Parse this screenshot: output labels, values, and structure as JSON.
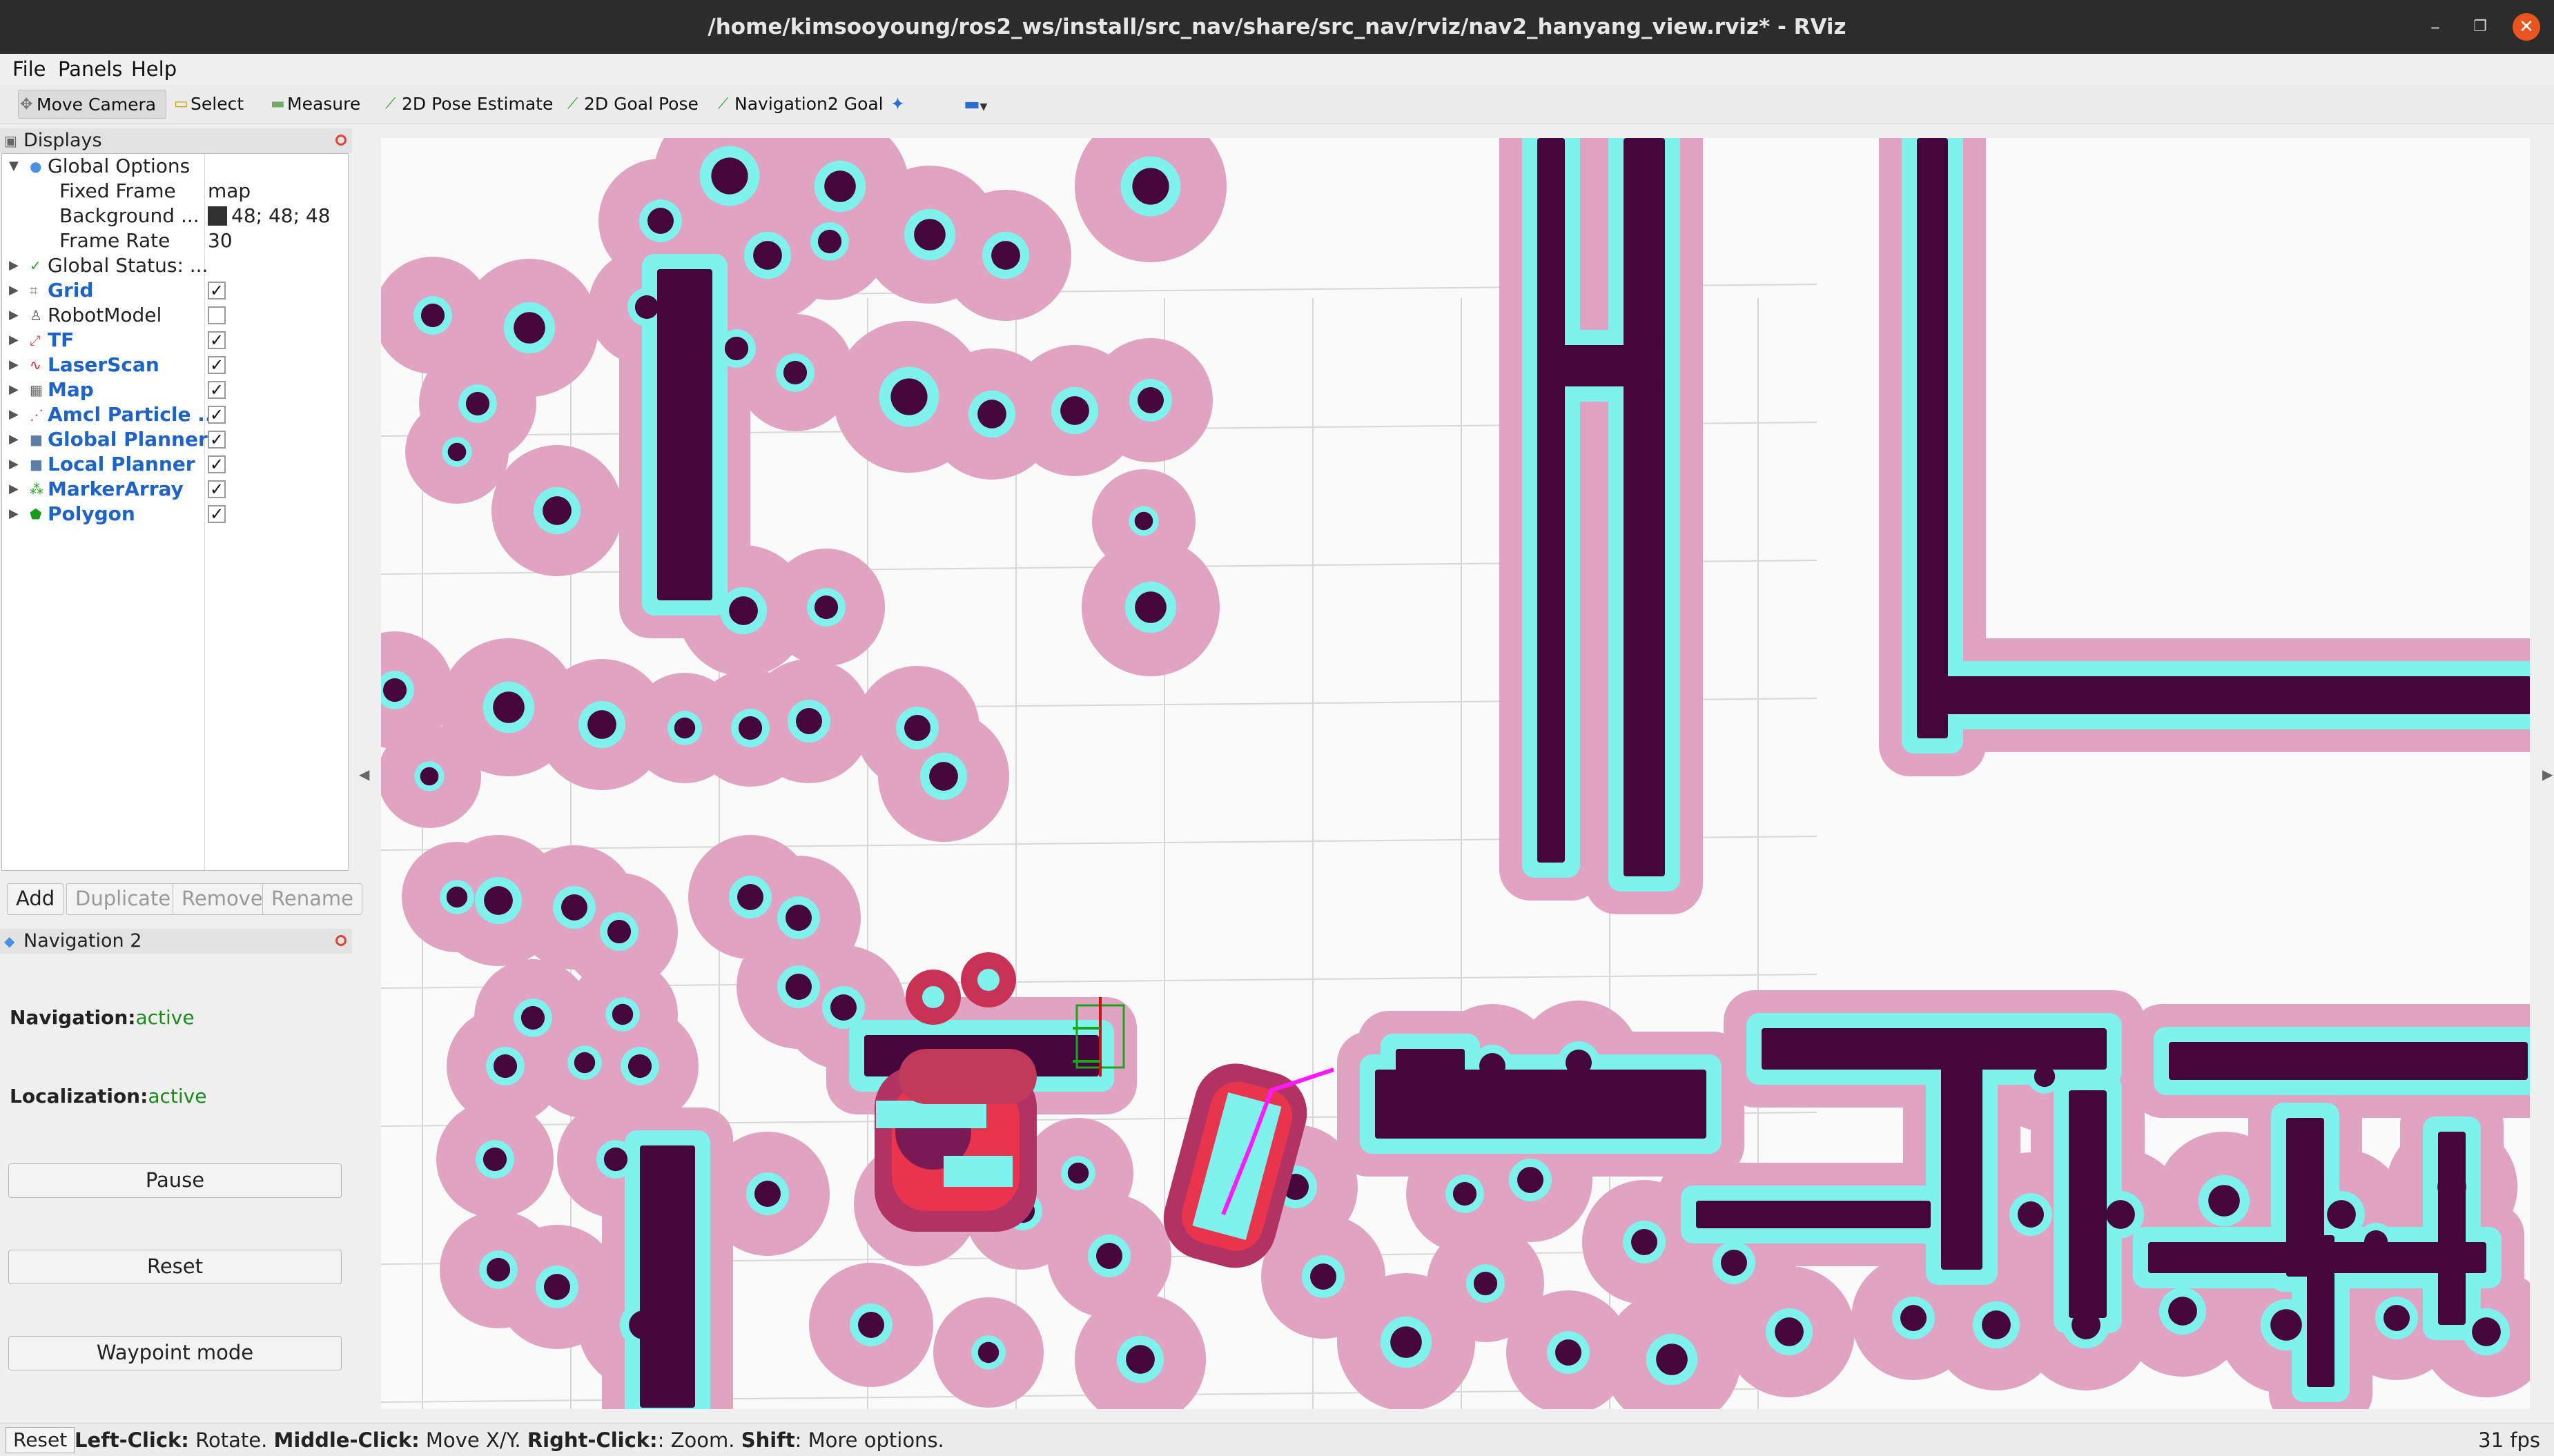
{
  "window": {
    "title": "/home/kimsooyoung/ros2_ws/install/src_nav/share/src_nav/rviz/nav2_hanyang_view.rviz* - RViz"
  },
  "menu": [
    "File",
    "Panels",
    "Help"
  ],
  "toolbar": {
    "move_camera": "Move Camera",
    "select": "Select",
    "measure": "Measure",
    "pose_estimate": "2D Pose Estimate",
    "goal_pose": "2D Goal Pose",
    "nav2_goal": "Navigation2 Goal"
  },
  "displays": {
    "title": "Displays",
    "global_options": "Global Options",
    "fixed_frame": {
      "label": "Fixed Frame",
      "value": "map"
    },
    "background": {
      "label": "Background ...",
      "value": "48; 48; 48",
      "color": "#303030"
    },
    "frame_rate": {
      "label": "Frame Rate",
      "value": "30"
    },
    "global_status": "Global Status: ...",
    "items": [
      {
        "label": "Grid",
        "checked": true
      },
      {
        "label": "RobotModel",
        "checked": false
      },
      {
        "label": "TF",
        "checked": true
      },
      {
        "label": "LaserScan",
        "checked": true
      },
      {
        "label": "Map",
        "checked": true
      },
      {
        "label": "Amcl Particle ...",
        "checked": true
      },
      {
        "label": "Global Planner",
        "checked": true
      },
      {
        "label": "Local Planner",
        "checked": true
      },
      {
        "label": "MarkerArray",
        "checked": true
      },
      {
        "label": "Polygon",
        "checked": true
      }
    ],
    "check_mark": "✓",
    "buttons": {
      "add": "Add",
      "duplicate": "Duplicate",
      "remove": "Remove",
      "rename": "Rename"
    }
  },
  "navigation": {
    "title": "Navigation 2",
    "nav_label": "Navigation:",
    "nav_state": "active",
    "loc_label": "Localization:",
    "loc_state": "active",
    "pause": "Pause",
    "reset": "Reset",
    "waypoint": "Waypoint mode"
  },
  "status": {
    "reset": "Reset",
    "left_click": "Left-Click:",
    "left_action": " Rotate. ",
    "middle_click": "Middle-Click:",
    "middle_action": " Move X/Y. ",
    "right_click": "Right-Click:",
    "right_action": ": Zoom. ",
    "shift": "Shift",
    "shift_action": ": More options.",
    "fps": "31 fps"
  },
  "colors": {
    "inflation": "#e0a3c1",
    "cyan": "#7ff2ee",
    "obstacle": "#45063d",
    "local_costmap_dark": "#7a1a55",
    "local_costmap_red": "#e8354d",
    "robot_green": "#1ca51c",
    "robot_red": "#cc1111"
  },
  "icons": {
    "move_camera": "move-camera-icon",
    "select": "select-icon",
    "measure": "measure-icon"
  }
}
